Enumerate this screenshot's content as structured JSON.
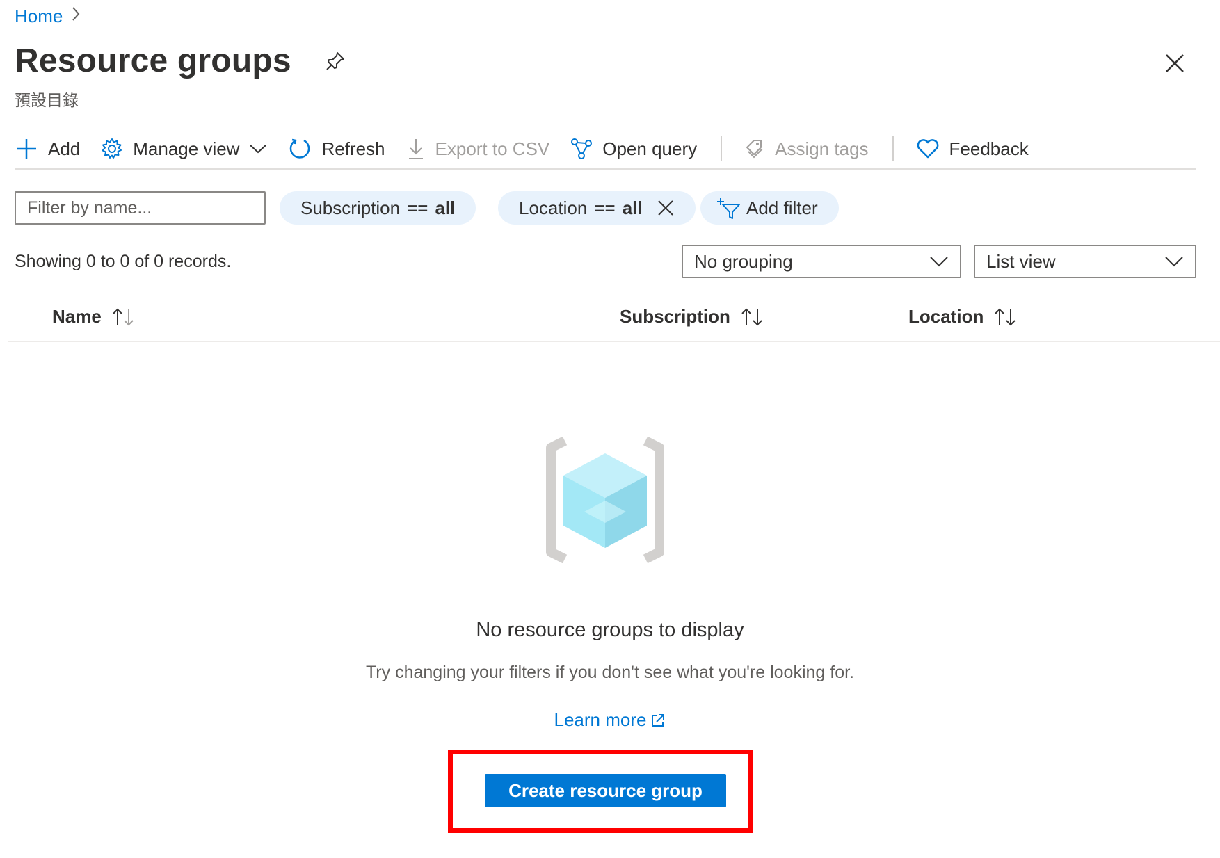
{
  "breadcrumb": {
    "home": "Home",
    "separator": "›"
  },
  "header": {
    "title": "Resource groups",
    "subtitle": "預設目錄"
  },
  "toolbar": {
    "add": "Add",
    "manage_view": "Manage view",
    "refresh": "Refresh",
    "export_csv": "Export to CSV",
    "open_query": "Open query",
    "assign_tags": "Assign tags",
    "feedback": "Feedback"
  },
  "filters": {
    "name_placeholder": "Filter by name...",
    "subscription": {
      "label": "Subscription",
      "op": "==",
      "value": "all"
    },
    "location": {
      "label": "Location",
      "op": "==",
      "value": "all"
    },
    "add_filter": "Add filter"
  },
  "records_text": "Showing 0 to 0 of 0 records.",
  "grouping": {
    "selected": "No grouping"
  },
  "view": {
    "selected": "List view"
  },
  "table": {
    "columns": [
      "Name",
      "Subscription",
      "Location"
    ]
  },
  "empty_state": {
    "title": "No resource groups to display",
    "description": "Try changing your filters if you don't see what you're looking for.",
    "learn_more": "Learn more",
    "create_button": "Create resource group"
  },
  "colors": {
    "accent": "#0078d4",
    "highlight": "#ff0000",
    "pill_bg": "#e8f2fc"
  }
}
